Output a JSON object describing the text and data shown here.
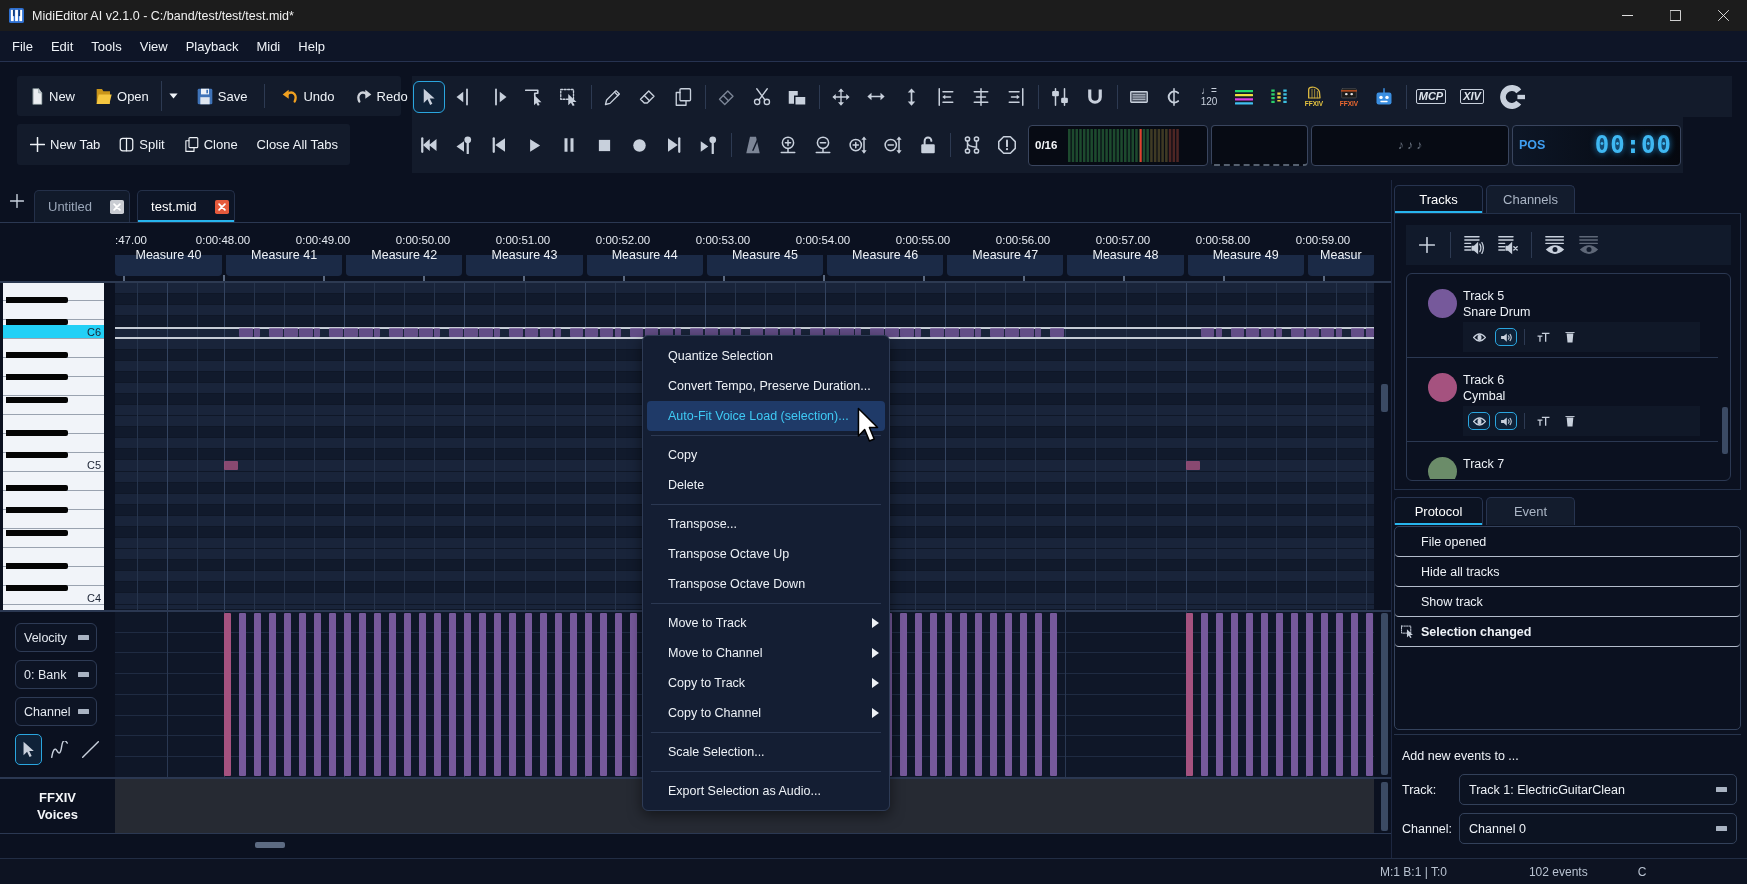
{
  "window": {
    "title": "MidiEditor AI v2.1.0 - C:/band/test/test/test.mid*"
  },
  "menu": [
    "File",
    "Edit",
    "Tools",
    "View",
    "Playback",
    "Midi",
    "Help"
  ],
  "file_toolbar": [
    [
      {
        "kind": "new",
        "label": "New"
      },
      {
        "kind": "open",
        "label": "Open"
      }
    ],
    [
      {
        "kind": "dropdown"
      },
      {
        "kind": "save",
        "label": "Save"
      }
    ],
    [
      {
        "kind": "undo",
        "label": "Undo"
      },
      {
        "kind": "redo",
        "label": "Redo"
      }
    ]
  ],
  "tab_toolbar": [
    {
      "kind": "new_tab",
      "label": "New Tab"
    },
    {
      "kind": "split",
      "label": "Split"
    },
    {
      "kind": "clone",
      "label": "Clone"
    },
    {
      "kind": "text",
      "label": "Close All Tabs"
    }
  ],
  "tool_groups": [
    [
      {
        "kind": "select",
        "selected": true
      },
      {
        "kind": "select_left",
        "selected": false
      },
      {
        "kind": "select_right",
        "selected": false
      },
      {
        "kind": "select_single",
        "selected": false
      },
      {
        "kind": "select_box",
        "selected": false
      }
    ],
    [
      {
        "kind": "pencil",
        "selected": false
      },
      {
        "kind": "eraser",
        "selected": false
      },
      {
        "kind": "copy",
        "selected": false
      }
    ],
    [
      {
        "kind": "glue",
        "selected": false
      },
      {
        "kind": "scissors",
        "selected": false
      },
      {
        "kind": "stamp",
        "selected": false
      }
    ],
    [
      {
        "kind": "move",
        "selected": false
      },
      {
        "kind": "move_h",
        "selected": false
      },
      {
        "kind": "move_v",
        "selected": false
      },
      {
        "kind": "align_left",
        "selected": false
      },
      {
        "kind": "align_center",
        "selected": false
      },
      {
        "kind": "align_right",
        "selected": false
      }
    ],
    [
      {
        "kind": "quantize",
        "selected": false
      },
      {
        "kind": "magnet",
        "selected": false
      }
    ],
    [
      {
        "kind": "lines_box",
        "selected": false
      },
      {
        "kind": "cent",
        "selected": false
      },
      {
        "kind": "tempo",
        "selected": false,
        "label": "♩=",
        "sub": "120"
      },
      {
        "kind": "bars",
        "selected": false
      },
      {
        "kind": "dots",
        "selected": false
      },
      {
        "kind": "harp",
        "selected": false,
        "label": "FFXIV"
      },
      {
        "kind": "chest",
        "selected": false,
        "label": "FFXIV"
      },
      {
        "kind": "robot",
        "selected": false
      }
    ],
    [
      {
        "kind": "badge",
        "selected": false,
        "label": "MCP"
      },
      {
        "kind": "badge",
        "selected": false,
        "label": "XIV"
      },
      {
        "kind": "crescent",
        "selected": false
      }
    ]
  ],
  "transport_groups": [
    [
      {
        "kind": "to_start"
      },
      {
        "kind": "marker_back"
      },
      {
        "kind": "back"
      },
      {
        "kind": "play"
      },
      {
        "kind": "pause"
      },
      {
        "kind": "stop"
      },
      {
        "kind": "record"
      },
      {
        "kind": "forward"
      },
      {
        "kind": "marker_forward"
      }
    ],
    [
      {
        "kind": "metronome"
      },
      {
        "kind": "zoom_h_in"
      },
      {
        "kind": "zoom_h_out"
      },
      {
        "kind": "zoom_v_in"
      },
      {
        "kind": "zoom_v_out"
      },
      {
        "kind": "lock"
      }
    ],
    [
      {
        "kind": "branch"
      },
      {
        "kind": "alert"
      }
    ]
  ],
  "displays": {
    "voice_count": "0/16",
    "notes": "♪ ♪ ♪",
    "pos_label": "POS",
    "pos_time": "00:00"
  },
  "tabs": [
    {
      "label": "Untitled",
      "selected": false
    },
    {
      "label": "test.mid",
      "selected": true
    }
  ],
  "ruler": {
    "times": [
      ":47.00",
      "0:00:48.00",
      "0:00:49.00",
      "0:00:50.00",
      "0:00:51.00",
      "0:00:52.00",
      "0:00:53.00",
      "0:00:54.00",
      "0:00:55.00",
      "0:00:56.00",
      "0:00:57.00",
      "0:00:58.00",
      "0:00:59.00"
    ],
    "measures": [
      "Measure 40",
      "Measure 41",
      "Measure 42",
      "Measure 43",
      "Measure 44",
      "Measure 45",
      "Measure 46",
      "Measure 47",
      "Measure 48",
      "Measure 49",
      "Measur"
    ]
  },
  "piano": {
    "keys": [
      {
        "label": "C6",
        "highlighted": true
      },
      {
        "label": "C5",
        "highlighted": false
      },
      {
        "label": "C4",
        "highlighted": false
      }
    ]
  },
  "velocity_panel": {
    "dropdowns": [
      "Velocity",
      "0: Bank",
      "Channel"
    ],
    "tools": [
      {
        "kind": "select",
        "selected": true
      },
      {
        "kind": "curve",
        "selected": false
      },
      {
        "kind": "line",
        "selected": false
      }
    ]
  },
  "voices_lane": {
    "label": "FFXIV Voices"
  },
  "context_menu": {
    "groups": [
      [
        {
          "label": "Quantize Selection",
          "highlighted": false,
          "submenu": false
        },
        {
          "label": "Convert Tempo, Preserve Duration...",
          "highlighted": false,
          "submenu": false
        },
        {
          "label": "Auto-Fit Voice Load (selection)...",
          "highlighted": true,
          "submenu": false
        }
      ],
      [
        {
          "label": "Copy",
          "highlighted": false,
          "submenu": false
        },
        {
          "label": "Delete",
          "highlighted": false,
          "submenu": false
        }
      ],
      [
        {
          "label": "Transpose...",
          "highlighted": false,
          "submenu": false
        },
        {
          "label": "Transpose Octave Up",
          "highlighted": false,
          "submenu": false
        },
        {
          "label": "Transpose Octave Down",
          "highlighted": false,
          "submenu": false
        }
      ],
      [
        {
          "label": "Move to Track",
          "highlighted": false,
          "submenu": true
        },
        {
          "label": "Move to Channel",
          "highlighted": false,
          "submenu": true
        },
        {
          "label": "Copy to Track",
          "highlighted": false,
          "submenu": true
        },
        {
          "label": "Copy to Channel",
          "highlighted": false,
          "submenu": true
        }
      ],
      [
        {
          "label": "Scale Selection...",
          "highlighted": false,
          "submenu": false
        }
      ],
      [
        {
          "label": "Export Selection as Audio...",
          "highlighted": false,
          "submenu": false
        }
      ]
    ]
  },
  "panel_tabs": [
    {
      "label": "Tracks",
      "selected": true
    },
    {
      "label": "Channels",
      "selected": false
    }
  ],
  "track_toolbar": [
    [
      {
        "kind": "add",
        "disabled": false
      }
    ],
    [
      {
        "kind": "list_sound",
        "disabled": false
      },
      {
        "kind": "list_mute",
        "disabled": false
      }
    ],
    [
      {
        "kind": "list_eye",
        "disabled": false
      },
      {
        "kind": "list_eye",
        "disabled": true
      }
    ]
  ],
  "tracks": [
    {
      "name": "Track 5",
      "instrument": "Snare Drum",
      "color": "#76599b",
      "visible": false,
      "audible": true
    },
    {
      "name": "Track 6",
      "instrument": "Cymbal",
      "color": "#a5527f",
      "visible": true,
      "audible": true
    },
    {
      "name": "Track 7",
      "color": "#6b8c69"
    }
  ],
  "log_tabs": [
    {
      "label": "Protocol",
      "selected": true
    },
    {
      "label": "Event",
      "selected": false
    }
  ],
  "protocol": [
    {
      "text": "File opened",
      "current": false
    },
    {
      "text": "Hide all tracks",
      "current": false
    },
    {
      "text": "Show track",
      "current": false
    },
    {
      "text": "Selection changed",
      "current": true
    }
  ],
  "new_events": {
    "heading": "Add new events to ...",
    "fields": [
      {
        "label": "Track:",
        "value": "Track 1: ElectricGuitarClean"
      },
      {
        "label": "Channel:",
        "value": "Channel 0"
      }
    ]
  },
  "status_bar": {
    "position": "M:1 B:1 | T:0",
    "events": "102 events",
    "key": "C"
  }
}
